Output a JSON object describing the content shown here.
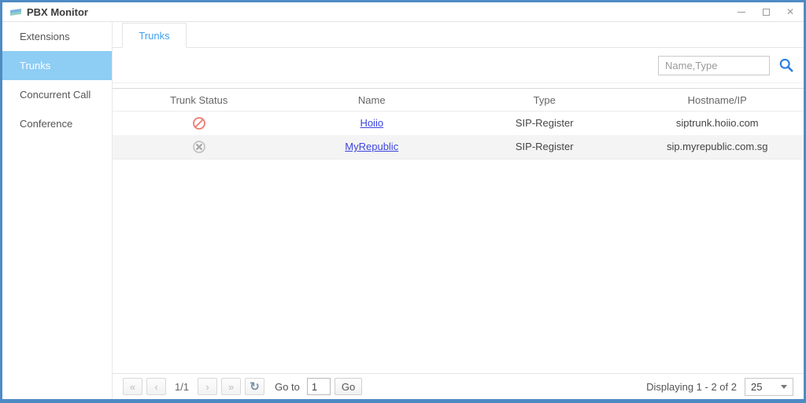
{
  "window": {
    "title": "PBX Monitor",
    "controls": {
      "close_glyph": "✕"
    }
  },
  "sidebar": {
    "items": [
      {
        "label": "Extensions"
      },
      {
        "label": "Trunks"
      },
      {
        "label": "Concurrent Call"
      },
      {
        "label": "Conference"
      }
    ]
  },
  "tabs": [
    {
      "label": "Trunks"
    }
  ],
  "toolbar": {
    "search_placeholder": "Name,Type"
  },
  "table": {
    "columns": [
      "Trunk Status",
      "Name",
      "Type",
      "Hostname/IP"
    ],
    "rows": [
      {
        "status": "blocked",
        "name": "Hoiio",
        "type": "SIP-Register",
        "hostname": "siptrunk.hoiio.com"
      },
      {
        "status": "disconnected",
        "name": "MyRepublic",
        "type": "SIP-Register",
        "hostname": "sip.myrepublic.com.sg"
      }
    ]
  },
  "pagination": {
    "first_icon": "«",
    "prev_icon": "‹",
    "page_indicator": "1/1",
    "next_icon": "›",
    "last_icon": "»",
    "refresh_icon": "↻",
    "goto_label": "Go to",
    "goto_value": "1",
    "go_button": "Go",
    "displaying": "Displaying 1 - 2 of 2",
    "page_size": "25"
  },
  "colors": {
    "window_border": "#4e8bc4",
    "sidebar_active_bg": "#8ecdf4",
    "tab_active_text": "#3fa0f3",
    "search_icon": "#2f7fe0",
    "link": "#3c45dd",
    "status_blocked": "#ee7a72",
    "status_disconnected": "#b0b0b0",
    "row_alt_bg": "#f4f4f4"
  }
}
